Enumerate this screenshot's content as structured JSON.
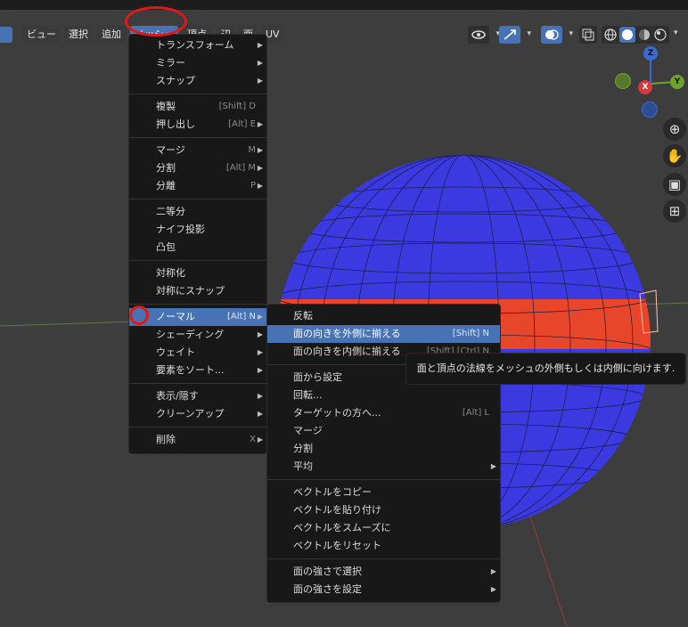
{
  "header": {
    "menus": [
      "ビュー",
      "選択",
      "追加",
      "メッシュ",
      "頂点",
      "辺",
      "面",
      "UV"
    ]
  },
  "mesh_menu": {
    "groups": [
      [
        {
          "label": "トランスフォーム",
          "submenu": true
        },
        {
          "label": "ミラー",
          "submenu": true
        },
        {
          "label": "スナップ",
          "submenu": true
        }
      ],
      [
        {
          "label": "複製",
          "shortcut": "[Shift] D"
        },
        {
          "label": "押し出し",
          "shortcut": "[Alt] E",
          "submenu": true
        }
      ],
      [
        {
          "label": "マージ",
          "shortcut": "M",
          "submenu": true
        },
        {
          "label": "分割",
          "shortcut": "[Alt] M",
          "submenu": true
        },
        {
          "label": "分離",
          "shortcut": "P",
          "submenu": true
        }
      ],
      [
        {
          "label": "二等分"
        },
        {
          "label": "ナイフ投影"
        },
        {
          "label": "凸包"
        }
      ],
      [
        {
          "label": "対称化"
        },
        {
          "label": "対称にスナップ"
        }
      ],
      [
        {
          "label": "ノーマル",
          "shortcut": "[Alt] N",
          "submenu": true,
          "highlighted": true
        },
        {
          "label": "シェーディング",
          "submenu": true
        },
        {
          "label": "ウェイト",
          "submenu": true
        },
        {
          "label": "要素をソート...",
          "submenu": true
        }
      ],
      [
        {
          "label": "表示/隠す",
          "submenu": true
        },
        {
          "label": "クリーンアップ",
          "submenu": true
        }
      ],
      [
        {
          "label": "削除",
          "shortcut": "X",
          "submenu": true
        }
      ]
    ]
  },
  "normals_submenu": {
    "groups": [
      [
        {
          "label": "反転"
        },
        {
          "label": "面の向きを外側に揃える",
          "shortcut": "[Shift] N",
          "highlighted": true
        },
        {
          "label": "面の向きを内側に揃える",
          "shortcut": "[Shift] [Ctrl] N"
        }
      ],
      [
        {
          "label": "面から設定"
        },
        {
          "label": "回転..."
        },
        {
          "label": "ターゲットの方へ...",
          "shortcut": "[Alt] L"
        },
        {
          "label": "マージ"
        },
        {
          "label": "分割"
        },
        {
          "label": "平均",
          "submenu": true
        }
      ],
      [
        {
          "label": "ベクトルをコピー"
        },
        {
          "label": "ベクトルを貼り付け"
        },
        {
          "label": "ベクトルをスムーズに"
        },
        {
          "label": "ベクトルをリセット"
        }
      ],
      [
        {
          "label": "面の強さで選択",
          "submenu": true
        },
        {
          "label": "面の強さを設定",
          "submenu": true
        }
      ]
    ]
  },
  "tooltip": "面と頂点の法線をメッシュの外側もしくは内側に向けます.",
  "gizmo": {
    "z": "Z",
    "x": "X",
    "y": "Y"
  },
  "colors": {
    "accent": "#4772b3",
    "sphere": "#3a3ae0",
    "band": "#e8462a",
    "annotation": "#e01818"
  }
}
